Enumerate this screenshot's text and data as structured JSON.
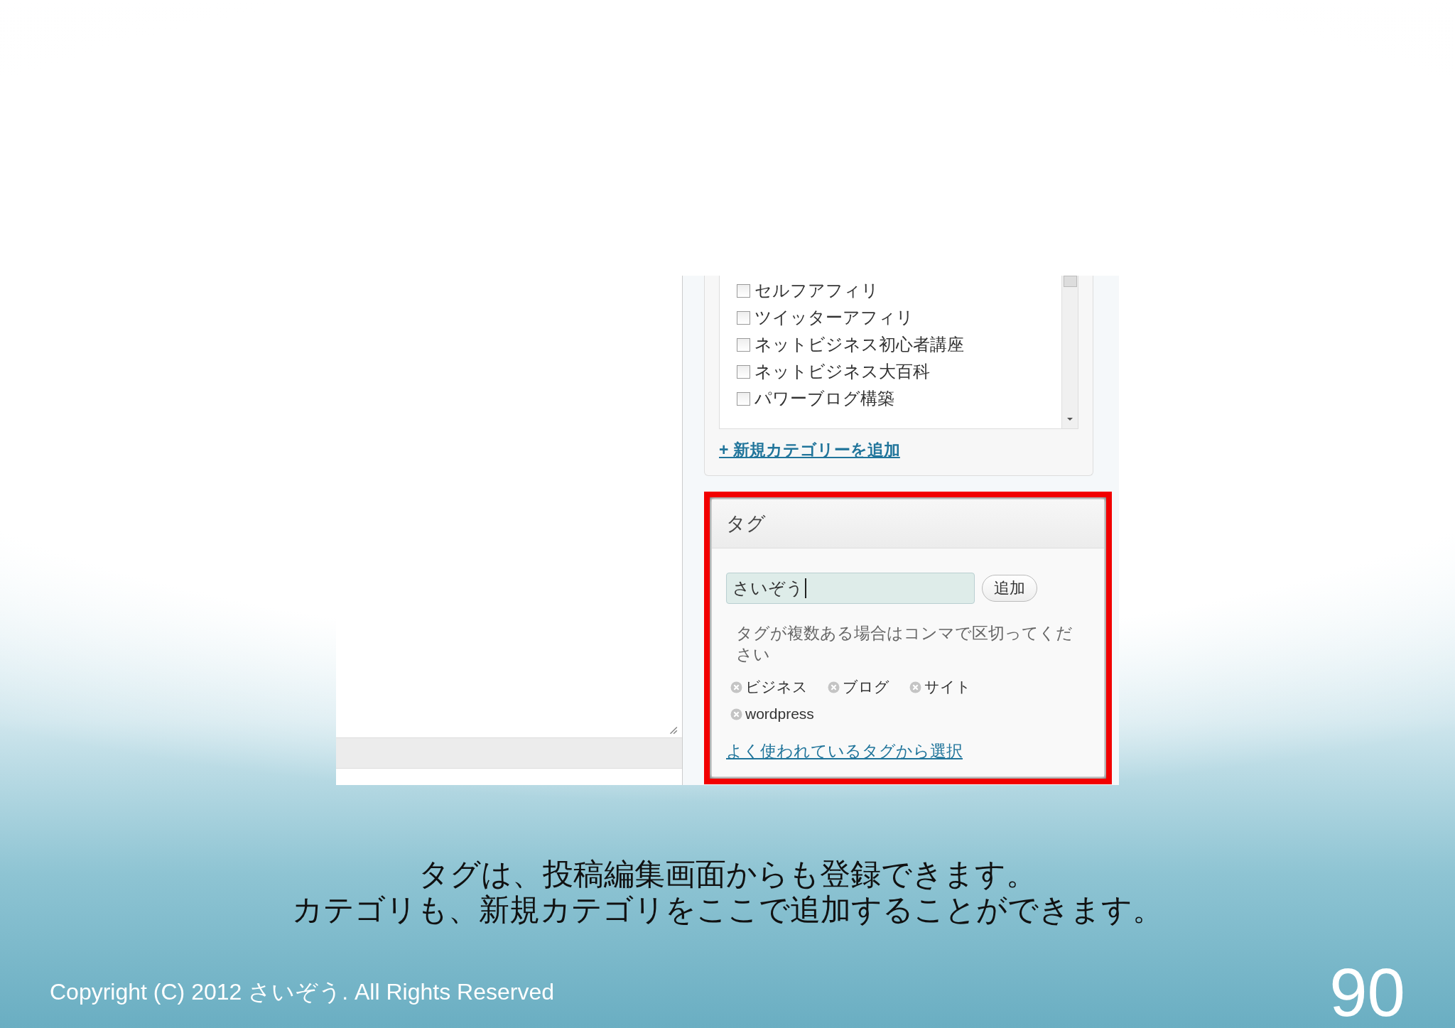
{
  "categories": {
    "items": [
      {
        "label": "セルフアフィリ",
        "checked": false
      },
      {
        "label": "ツイッターアフィリ",
        "checked": false
      },
      {
        "label": "ネットビジネス初心者講座",
        "checked": false
      },
      {
        "label": "ネットビジネス大百科",
        "checked": false
      },
      {
        "label": "パワーブログ構築",
        "checked": false
      }
    ],
    "add_link": "+ 新規カテゴリーを追加"
  },
  "tag_box": {
    "title": "タグ",
    "input": {
      "value": "さいぞう"
    },
    "add_button": "追加",
    "hint": "タグが複数ある場合はコンマで区切ってください",
    "tags": [
      "ビジネス",
      "ブログ",
      "サイト",
      "wordpress"
    ],
    "popular_link": "よく使われているタグから選択"
  },
  "caption": [
    "タグは、投稿編集画面からも登録できます。",
    "カテゴリも、新規カテゴリをここで追加することができます。"
  ],
  "footer": {
    "copyright": "Copyright (C) 2012 さいぞう. All Rights Reserved",
    "page_number": "90"
  }
}
